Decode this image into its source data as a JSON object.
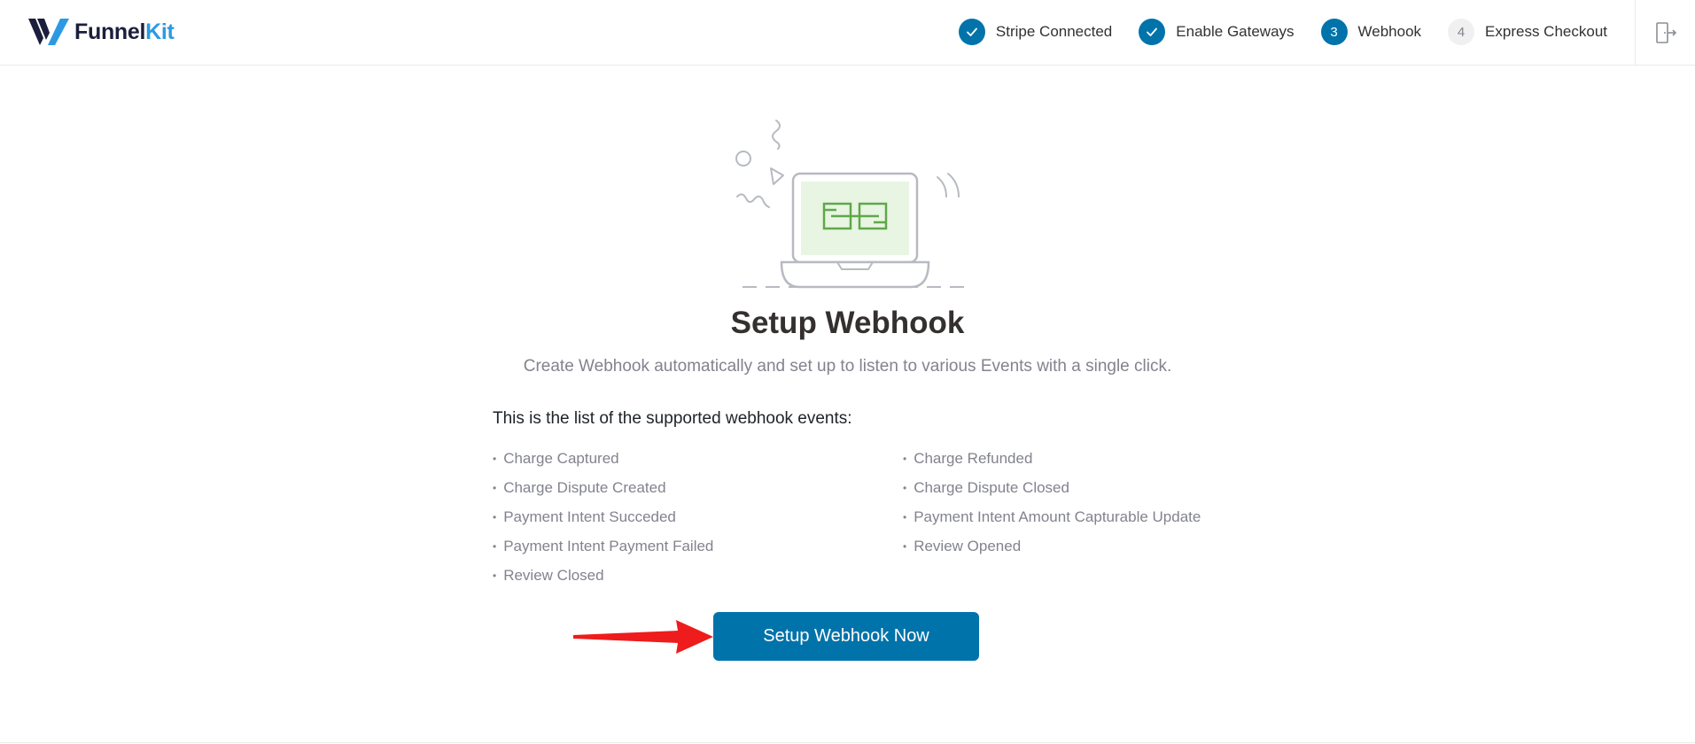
{
  "brand": {
    "name_part1": "Funnel",
    "name_part2": "Kit",
    "colors": {
      "dark": "#1b1f3b",
      "light": "#2c9ae3"
    }
  },
  "steps": [
    {
      "badge": "✓",
      "label": "Stripe Connected",
      "state": "done"
    },
    {
      "badge": "✓",
      "label": "Enable Gateways",
      "state": "done"
    },
    {
      "badge": "3",
      "label": "Webhook",
      "state": "active"
    },
    {
      "badge": "4",
      "label": "Express Checkout",
      "state": "pending"
    }
  ],
  "header": {
    "exit_icon": "exit-icon"
  },
  "main": {
    "title": "Setup Webhook",
    "subtitle": "Create Webhook automatically and set up to listen to various Events with a single click.",
    "events_heading": "This is the list of the supported webhook events:",
    "events_left": [
      "Charge Captured",
      "Charge Dispute Created",
      "Payment Intent Succeded",
      "Payment Intent Payment Failed",
      "Review Closed"
    ],
    "events_right": [
      "Charge Refunded",
      "Charge Dispute Closed",
      "Payment Intent Amount Capturable Update",
      "Review Opened"
    ],
    "cta_label": "Setup Webhook Now"
  },
  "colors": {
    "primary": "#0073aa",
    "muted_text": "#82838e",
    "illustration_accent": "#5fa84a",
    "annotation_arrow": "#ee1c1c"
  }
}
